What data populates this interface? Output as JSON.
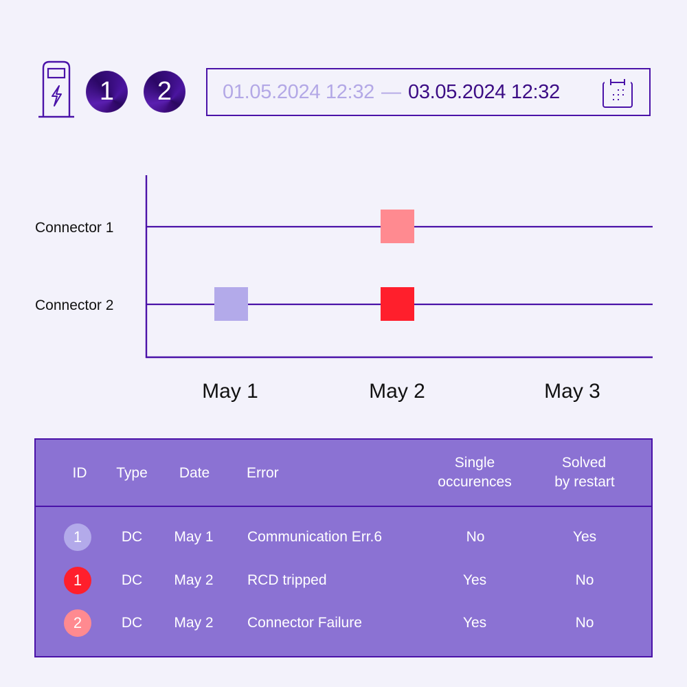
{
  "header": {
    "station_icon": "ev-charging-station-icon",
    "connectors": [
      {
        "label": "1"
      },
      {
        "label": "2"
      }
    ],
    "date_range": {
      "from": "01.05.2024 12:32",
      "separator": "—",
      "to": "03.05.2024 12:32",
      "icon": "calendar-icon"
    }
  },
  "colors": {
    "accent": "#4a12a8",
    "table_bg": "#8b72d3",
    "error_comm": "#b3aaea",
    "error_rcd": "#ff1f2c",
    "error_connector": "#ff8a90",
    "date_from": "#b3a8e6",
    "date_to": "#3c0d85"
  },
  "chart_data": {
    "type": "scatter",
    "title": "",
    "xlabel": "",
    "ylabel": "",
    "categories_y": [
      "Connector 1",
      "Connector 2"
    ],
    "x_ticks": [
      "May 1",
      "May 2",
      "May 3"
    ],
    "points": [
      {
        "connector": "Connector 2",
        "x": "May 1",
        "error": "Communication Err.6",
        "color": "#b3aaea"
      },
      {
        "connector": "Connector 1",
        "x": "May 2",
        "error": "Connector Failure",
        "color": "#ff8a90"
      },
      {
        "connector": "Connector 2",
        "x": "May 2",
        "error": "RCD tripped",
        "color": "#ff1f2c"
      }
    ],
    "grid": false,
    "legend": "none"
  },
  "table": {
    "headers": {
      "id": "ID",
      "type": "Type",
      "date": "Date",
      "error": "Error",
      "single_line1": "Single",
      "single_line2": "occurences",
      "solved_line1": "Solved",
      "solved_line2": "by restart"
    },
    "rows": [
      {
        "id": "1",
        "id_color": "#b3aaea",
        "type": "DC",
        "date": "May 1",
        "error": "Communication Err.6",
        "single": "No",
        "solved": "Yes"
      },
      {
        "id": "1",
        "id_color": "#ff1f2c",
        "type": "DC",
        "date": "May 2",
        "error": "RCD tripped",
        "single": "Yes",
        "solved": "No"
      },
      {
        "id": "2",
        "id_color": "#ff8a90",
        "type": "DC",
        "date": "May 2",
        "error": "Connector Failure",
        "single": "Yes",
        "solved": "No"
      }
    ]
  }
}
